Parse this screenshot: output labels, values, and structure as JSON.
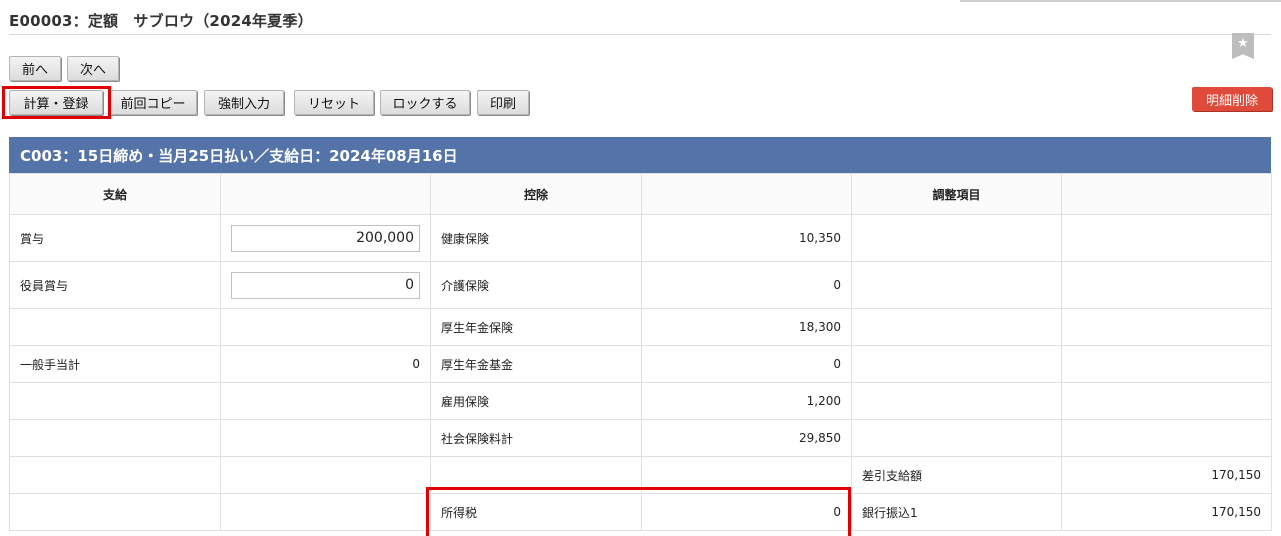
{
  "title": "E00003：定額　サブロウ（2024年夏季）",
  "nav": {
    "prev": "前へ",
    "next": "次へ"
  },
  "toolbar": {
    "calc": "計算・登録",
    "copy_prev": "前回コピー",
    "force_input": "強制入力",
    "reset": "リセット",
    "lock": "ロックする",
    "print": "印刷",
    "delete_detail": "明細削除"
  },
  "star_glyph": "★",
  "section": {
    "title": "C003：15日締め・当月25日払い／支給日：2024年08月16日"
  },
  "columns": {
    "payment": "支給",
    "deduction": "控除",
    "adjustment": "調整項目"
  },
  "rows": [
    {
      "pay_label": "賞与",
      "pay_input": "200,000",
      "ded_label": "健康保険",
      "ded_value": "10,350",
      "adj_label": "",
      "adj_value": ""
    },
    {
      "pay_label": "役員賞与",
      "pay_input": "0",
      "ded_label": "介護保険",
      "ded_value": "0",
      "adj_label": "",
      "adj_value": ""
    },
    {
      "pay_label": "",
      "pay_value": "",
      "ded_label": "厚生年金保険",
      "ded_value": "18,300",
      "adj_label": "",
      "adj_value": ""
    },
    {
      "pay_label": "一般手当計",
      "pay_value": "0",
      "ded_label": "厚生年金基金",
      "ded_value": "0",
      "adj_label": "",
      "adj_value": ""
    },
    {
      "pay_label": "",
      "pay_value": "",
      "ded_label": "雇用保険",
      "ded_value": "1,200",
      "adj_label": "",
      "adj_value": ""
    },
    {
      "pay_label": "",
      "pay_value": "",
      "ded_label": "社会保険料計",
      "ded_value": "29,850",
      "adj_label": "",
      "adj_value": ""
    },
    {
      "pay_label": "",
      "pay_value": "",
      "ded_label": "",
      "ded_value": "",
      "adj_label": "差引支給額",
      "adj_value": "170,150"
    },
    {
      "pay_label": "",
      "pay_value": "",
      "ded_label": "所得税",
      "ded_value": "0",
      "adj_label": "銀行振込1",
      "adj_value": "170,150"
    }
  ]
}
